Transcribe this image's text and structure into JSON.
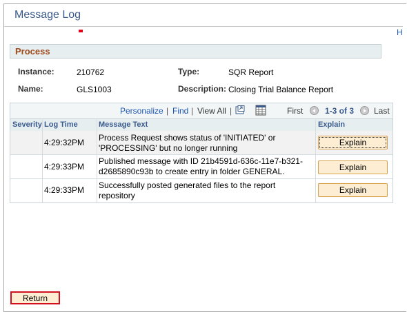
{
  "header": {
    "title": "Message Log",
    "help_link": "H"
  },
  "process": {
    "section_title": "Process",
    "instance_label": "Instance:",
    "instance_value": "210762",
    "type_label": "Type:",
    "type_value": "SQR Report",
    "name_label": "Name:",
    "name_value": "GLS1003",
    "description_label": "Description:",
    "description_value": "Closing Trial Balance Report"
  },
  "grid": {
    "personalize": "Personalize",
    "find": "Find",
    "view_all": "View All",
    "first": "First",
    "range": "1-3 of 3",
    "last": "Last",
    "columns": [
      "Severity",
      "Log Time",
      "Message Text",
      "Explain"
    ],
    "rows": [
      {
        "severity": "",
        "time": "4:29:32PM",
        "message": "Process Request shows status of 'INITIATED' or 'PROCESSING' but no longer running",
        "explain": "Explain"
      },
      {
        "severity": "",
        "time": "4:29:33PM",
        "message": "Published message with ID 21b4591d-636c-11e7-b321-d2685890c93b to create entry in folder GENERAL.",
        "explain": "Explain"
      },
      {
        "severity": "",
        "time": "4:29:33PM",
        "message": "Successfully posted generated files to the report repository",
        "explain": "Explain"
      }
    ]
  },
  "footer": {
    "return_label": "Return"
  },
  "icons": {
    "zoom": "zoom-grid-icon",
    "download": "download-spreadsheet-icon",
    "first": "chevron-left-circle-icon",
    "last": "chevron-right-circle-icon"
  },
  "colors": {
    "title": "#3a5a8c",
    "section": "#a04a1c",
    "link": "#1b57b5",
    "button_bg": "#fdedd2",
    "highlight": "#d0101e"
  }
}
